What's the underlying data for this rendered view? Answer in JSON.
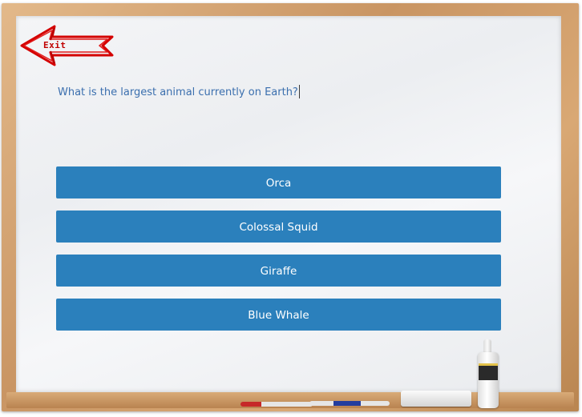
{
  "exit": {
    "label": "Exit",
    "icon": "arrow-left-icon",
    "color": "#c00000"
  },
  "question": {
    "text": "What is the largest animal currently on Earth?"
  },
  "answers": [
    {
      "label": "Orca"
    },
    {
      "label": "Colossal Squid"
    },
    {
      "label": "Giraffe"
    },
    {
      "label": "Blue Whale"
    }
  ],
  "colors": {
    "button": "#2b80bc",
    "button_text": "#ffffff",
    "question_text": "#3b6fae",
    "frame": "#c99563"
  }
}
